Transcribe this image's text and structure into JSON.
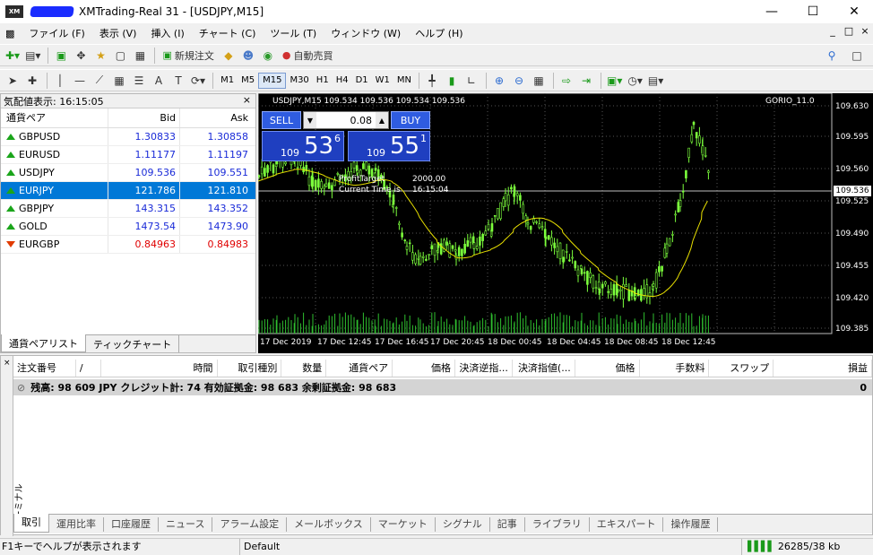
{
  "window": {
    "title": "XMTrading-Real 31 - [USDJPY,M15]",
    "logo": "XM"
  },
  "menu": [
    "ファイル (F)",
    "表示 (V)",
    "挿入 (I)",
    "チャート (C)",
    "ツール (T)",
    "ウィンドウ (W)",
    "ヘルプ (H)"
  ],
  "toolbar": {
    "new_order": "新規注文",
    "auto_trade": "自動売買",
    "timeframes": [
      "M1",
      "M5",
      "M15",
      "M30",
      "H1",
      "H4",
      "D1",
      "W1",
      "MN"
    ],
    "active_tf": "M15"
  },
  "market_watch": {
    "title": "気配値表示: 16:15:05",
    "col_symbol": "通貨ペア",
    "col_bid": "Bid",
    "col_ask": "Ask",
    "rows": [
      {
        "symbol": "GBPUSD",
        "bid": "1.30833",
        "ask": "1.30858",
        "dir": "up",
        "color": "blue"
      },
      {
        "symbol": "EURUSD",
        "bid": "1.11177",
        "ask": "1.11197",
        "dir": "up",
        "color": "blue"
      },
      {
        "symbol": "USDJPY",
        "bid": "109.536",
        "ask": "109.551",
        "dir": "up",
        "color": "blue"
      },
      {
        "symbol": "EURJPY",
        "bid": "121.786",
        "ask": "121.810",
        "dir": "up",
        "color": "blue"
      },
      {
        "symbol": "GBPJPY",
        "bid": "143.315",
        "ask": "143.352",
        "dir": "up",
        "color": "blue"
      },
      {
        "symbol": "GOLD",
        "bid": "1473.54",
        "ask": "1473.90",
        "dir": "up",
        "color": "blue"
      },
      {
        "symbol": "EURGBP",
        "bid": "0.84963",
        "ask": "0.84983",
        "dir": "down",
        "color": "red"
      }
    ],
    "selected_index": 3,
    "tabs": [
      "通貨ペアリスト",
      "ティックチャート"
    ]
  },
  "chart": {
    "header": "USDJPY,M15  109.534 109.536 109.534 109.536",
    "indicator": "GORIO_11.0",
    "sell_label": "SELL",
    "buy_label": "BUY",
    "lot": "0.08",
    "sell_price": {
      "prefix": "109",
      "big": "53",
      "sup": "6"
    },
    "buy_price": {
      "prefix": "109",
      "big": "55",
      "sup": "1"
    },
    "profit_label": "ProfitTarget",
    "profit_value": "2000,00",
    "time_label": "Current Time is",
    "time_value": "16:15:04",
    "current_price": "109.536",
    "y_labels": [
      "109.630",
      "109.595",
      "109.560",
      "109.525",
      "109.490",
      "109.455",
      "109.420",
      "109.385"
    ],
    "x_labels": [
      "17 Dec 2019",
      "17 Dec 12:45",
      "17 Dec 16:45",
      "17 Dec 20:45",
      "18 Dec 00:45",
      "18 Dec 04:45",
      "18 Dec 08:45",
      "18 Dec 12:45"
    ]
  },
  "terminal": {
    "vertical_label": "ターミナル",
    "columns": [
      "注文番号",
      "/",
      "時間",
      "取引種別",
      "数量",
      "通貨ペア",
      "価格",
      "決済逆指...",
      "決済指値(...",
      "価格",
      "手数料",
      "スワップ",
      "損益"
    ],
    "balance": "残高: 98 609 JPY  クレジット計: 74  有効証拠金: 98 683  余剰証拠金: 98 683",
    "balance_profit": "0",
    "tabs": [
      "取引",
      "運用比率",
      "口座履歴",
      "ニュース",
      "アラーム設定",
      "メールボックス",
      "マーケット",
      "シグナル",
      "記事",
      "ライブラリ",
      "エキスパート",
      "操作履歴"
    ]
  },
  "status": {
    "help": "F1キーでヘルプが表示されます",
    "profile": "Default",
    "traffic": "26285/38 kb"
  }
}
